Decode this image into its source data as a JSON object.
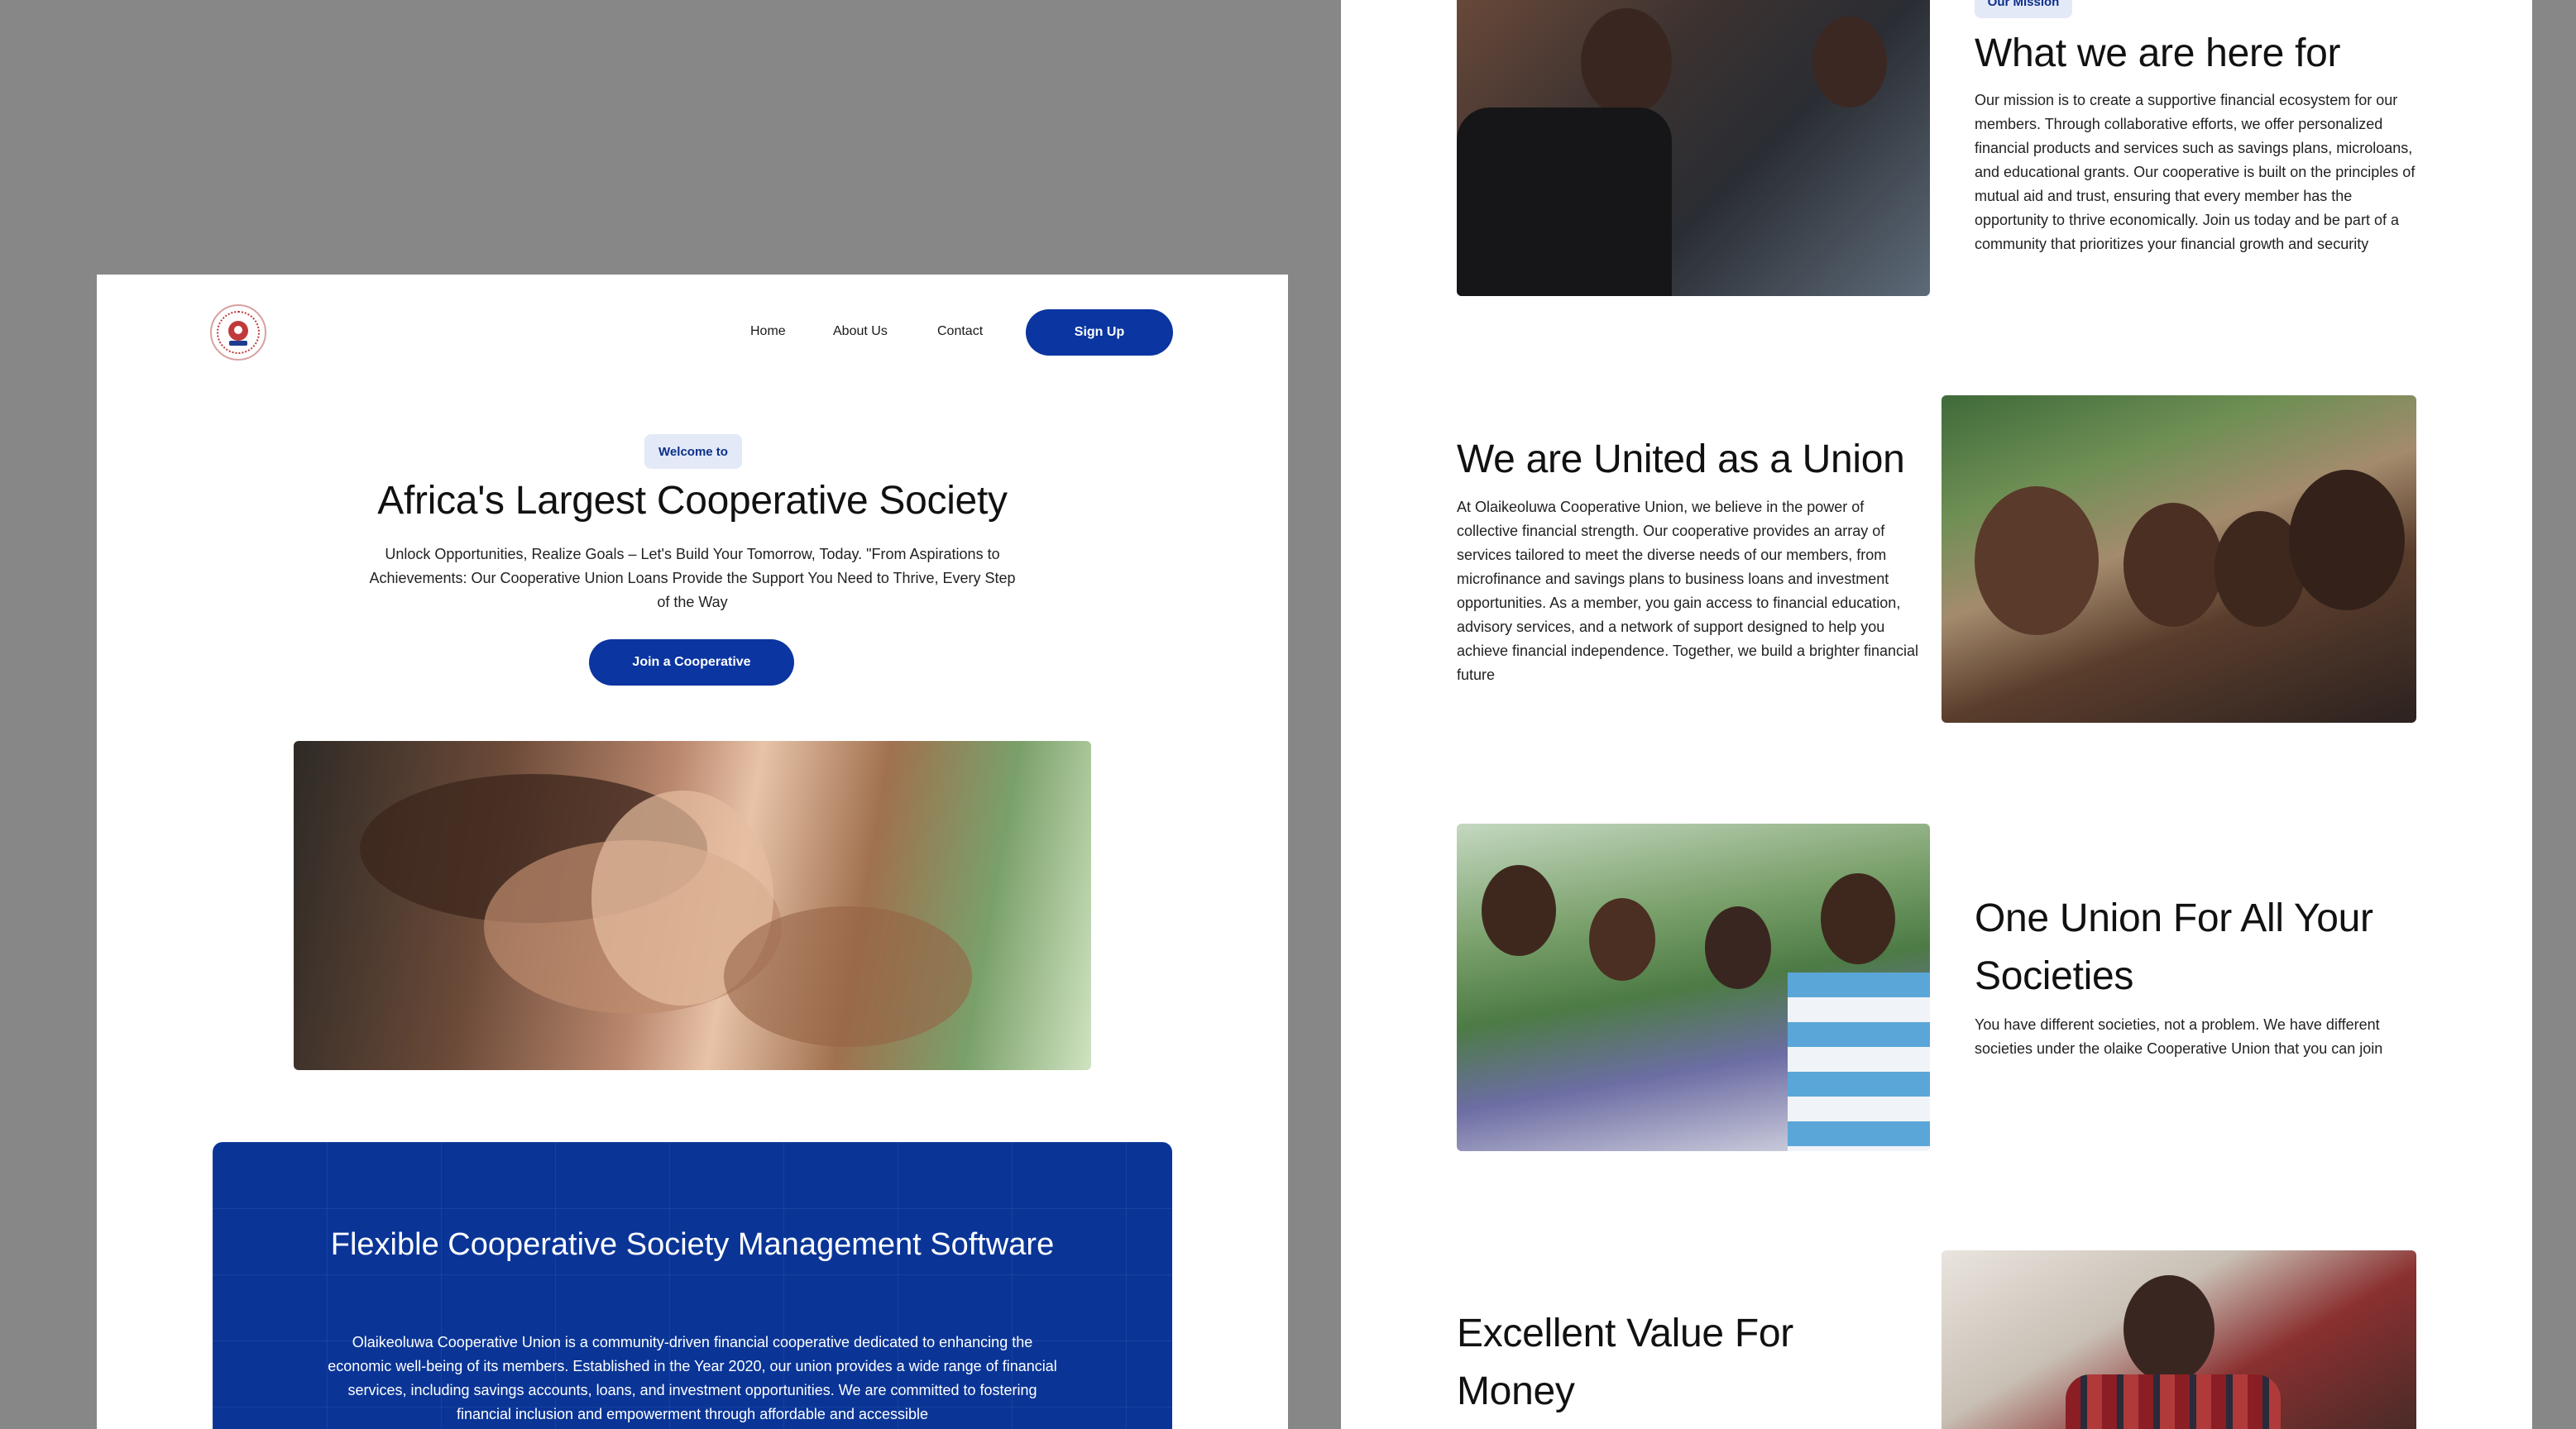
{
  "nav": {
    "home": "Home",
    "about": "About Us",
    "contact": "Contact",
    "signup": "Sign Up"
  },
  "hero": {
    "badge": "Welcome to",
    "title": "Africa's Largest Cooperative Society",
    "subtitle": "Unlock Opportunities, Realize Goals – Let's Build Your Tomorrow, Today. \"From Aspirations to Achievements: Our Cooperative Union Loans Provide the Support You Need to Thrive, Every Step of the Way",
    "cta": "Join a Cooperative"
  },
  "software_card": {
    "title": "Flexible Cooperative Society Management Software",
    "body": "Olaikeoluwa Cooperative Union is a community-driven financial cooperative dedicated to enhancing the economic well-being of its members. Established in the Year 2020, our union provides a wide range of financial services, including savings accounts, loans, and investment opportunities. We are committed to fostering financial inclusion and empowerment through affordable and accessible"
  },
  "mission": {
    "badge": "Our Mission",
    "title": "What we are here for",
    "body": "Our mission is to create a supportive financial ecosystem for our members. Through collaborative efforts, we offer personalized financial products and services such as savings plans, microloans, and educational grants. Our cooperative is built on the principles of mutual aid and trust, ensuring that every member has the opportunity to thrive economically. Join us today and be part of a community that prioritizes your financial growth and security"
  },
  "united": {
    "title": "We are United as a Union",
    "body": "At Olaikeoluwa Cooperative Union, we believe in the power of collective financial strength. Our cooperative provides an array of services tailored to meet the diverse needs of our members, from microfinance and savings plans to business loans and investment opportunities. As a member, you gain access to financial education, advisory services, and a network of support designed to help you achieve financial independence. Together, we build a brighter financial future"
  },
  "one_union": {
    "title": "One Union For All Your Societies",
    "body": "You have different societies, not a problem. We have different societies under the olaike Cooperative Union that you can join"
  },
  "value": {
    "title": "Excellent Value For Money"
  },
  "colors": {
    "brand_blue": "#0b35a0",
    "pill_bg": "#e3e9f7",
    "background": "#878787"
  }
}
